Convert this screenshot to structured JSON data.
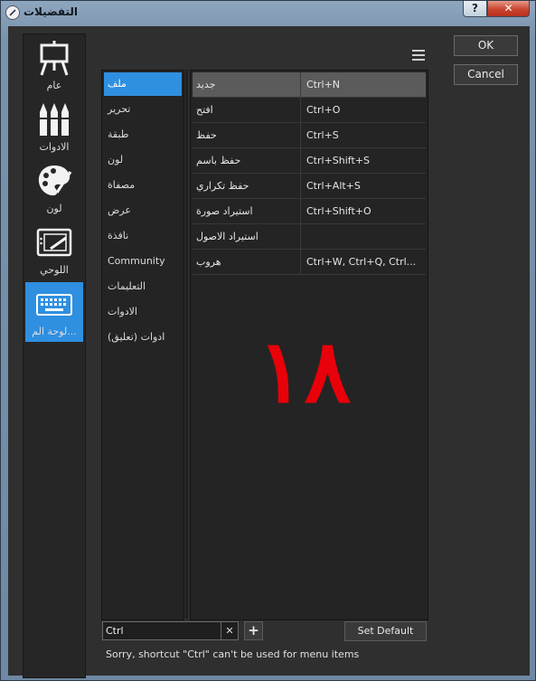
{
  "window": {
    "title": "التفضيلات",
    "help_label": "?",
    "close_label": "✕"
  },
  "categories": [
    {
      "label": "عام",
      "icon": "easel-icon"
    },
    {
      "label": "الادوات",
      "icon": "brushes-icon"
    },
    {
      "label": "لون",
      "icon": "palette-icon"
    },
    {
      "label": "اللوحي",
      "icon": "tablet-icon"
    },
    {
      "label": "لوحة الم...",
      "icon": "keyboard-icon",
      "active": true
    }
  ],
  "menu": {
    "items": [
      "ملف",
      "تحرير",
      "طبقة",
      "لون",
      "مصفاة",
      "عرض",
      "نافذة",
      "Community",
      "التعليمات",
      "الادوات",
      "(ادوات (تعليق"
    ],
    "active_index": 0
  },
  "shortcuts": {
    "rows": [
      {
        "command": "جديد",
        "shortcut": "Ctrl+N"
      },
      {
        "command": "افتح",
        "shortcut": "Ctrl+O"
      },
      {
        "command": "حفظ",
        "shortcut": "Ctrl+S"
      },
      {
        "command": "حفظ باسم",
        "shortcut": "Ctrl+Shift+S"
      },
      {
        "command": "حفظ تكراري",
        "shortcut": "Ctrl+Alt+S"
      },
      {
        "command": "استيراد صورة",
        "shortcut": "Ctrl+Shift+O"
      },
      {
        "command": "استيراد الاصول",
        "shortcut": ""
      },
      {
        "command": "هروب",
        "shortcut": "Ctrl+W, Ctrl+Q, Ctrl..."
      }
    ]
  },
  "overlay_number": "١٨",
  "search": {
    "value": "Ctrl",
    "clear_label": "✕"
  },
  "add_label": "+",
  "set_default_label": "Set Default",
  "status_message": "Sorry, shortcut \"Ctrl\" can't be used for menu items",
  "buttons": {
    "ok": "OK",
    "cancel": "Cancel"
  },
  "colors": {
    "accent": "#2f8fe0",
    "overlay": "#e8000a",
    "background": "#2f2f2f"
  }
}
